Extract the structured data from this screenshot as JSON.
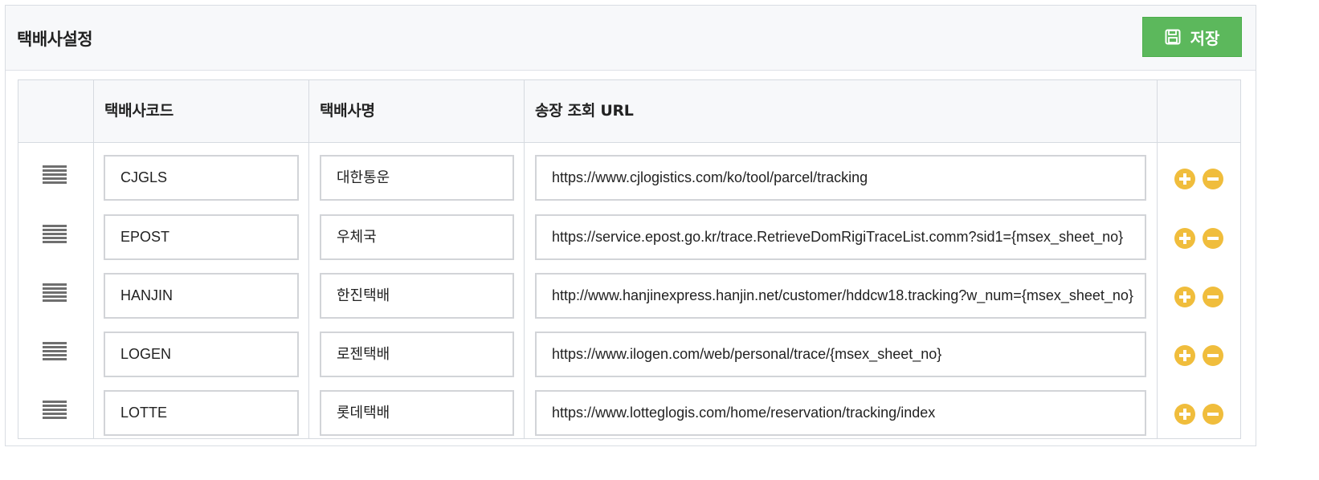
{
  "panel": {
    "title": "택배사설정",
    "save_label": "저장",
    "save_icon": "floppy-disk-icon"
  },
  "table": {
    "columns": [
      "",
      "택배사코드",
      "택배사명",
      "송장 조회 URL",
      ""
    ],
    "rows": [
      {
        "code": "CJGLS",
        "name": "대한통운",
        "url": "https://www.cjlogistics.com/ko/tool/parcel/tracking"
      },
      {
        "code": "EPOST",
        "name": "우체국",
        "url": "https://service.epost.go.kr/trace.RetrieveDomRigiTraceList.comm?sid1={msex_sheet_no}"
      },
      {
        "code": "HANJIN",
        "name": "한진택배",
        "url": "http://www.hanjinexpress.hanjin.net/customer/hddcw18.tracking?w_num={msex_sheet_no}"
      },
      {
        "code": "LOGEN",
        "name": "로젠택배",
        "url": "https://www.ilogen.com/web/personal/trace/{msex_sheet_no}"
      },
      {
        "code": "LOTTE",
        "name": "롯데택배",
        "url": "https://www.lotteglogis.com/home/reservation/tracking/index"
      }
    ],
    "row_icons": {
      "drag": "drag-handle-icon",
      "add": "plus-circle-icon",
      "remove": "minus-circle-icon"
    }
  },
  "colors": {
    "save_button": "#5cb85c",
    "action_circle": "#f0bd3c",
    "header_bg": "#f7f8fa",
    "border": "#d6dae0"
  }
}
